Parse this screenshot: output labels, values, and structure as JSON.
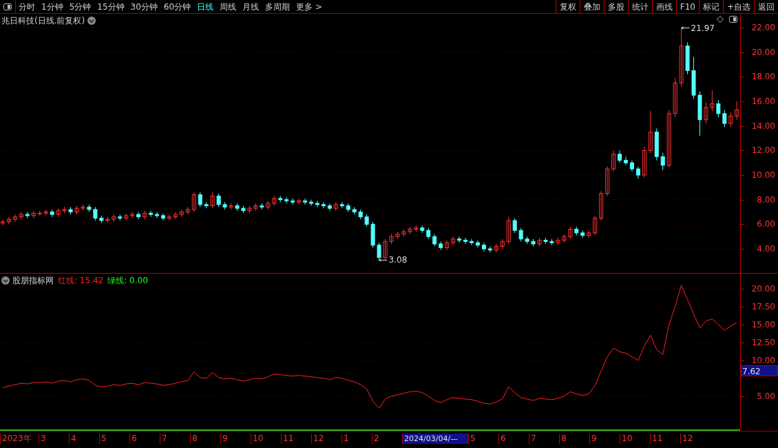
{
  "toolbar": {
    "periods": [
      {
        "label": "分时",
        "selected": false
      },
      {
        "label": "1分钟",
        "selected": false
      },
      {
        "label": "5分钟",
        "selected": false
      },
      {
        "label": "15分钟",
        "selected": false
      },
      {
        "label": "30分钟",
        "selected": false
      },
      {
        "label": "60分钟",
        "selected": false
      },
      {
        "label": "日线",
        "selected": true
      },
      {
        "label": "周线",
        "selected": false
      },
      {
        "label": "月线",
        "selected": false
      },
      {
        "label": "多周期",
        "selected": false
      },
      {
        "label": "更多 >",
        "selected": false
      }
    ],
    "actions": [
      "复权",
      "叠加",
      "多股",
      "统计",
      "画线",
      "F10",
      "标记",
      "+自选",
      "返回"
    ]
  },
  "price_pane": {
    "title": "兆日科技(日线.前复权)",
    "chart_data": {
      "type": "candlestick",
      "grid": true,
      "ylim": [
        2.04,
        23.12
      ],
      "yticks": [
        {
          "value": 4,
          "label": "4.00"
        },
        {
          "value": 6,
          "label": "6.00"
        },
        {
          "value": 8,
          "label": "8.00"
        },
        {
          "value": 10,
          "label": "10.00"
        },
        {
          "value": 12,
          "label": "12.00"
        },
        {
          "value": 14,
          "label": "14.00"
        },
        {
          "value": 16,
          "label": "16.00"
        },
        {
          "value": 18,
          "label": "18.00"
        },
        {
          "value": 20,
          "label": "20.00"
        },
        {
          "value": 22,
          "label": "22.00"
        }
      ],
      "ohlc": [
        [
          6.1,
          6.4,
          5.9,
          6.2
        ],
        [
          6.2,
          6.6,
          6.0,
          6.4
        ],
        [
          6.4,
          6.8,
          6.2,
          6.6
        ],
        [
          6.6,
          7.0,
          6.4,
          6.8
        ],
        [
          6.8,
          7.0,
          6.5,
          6.7
        ],
        [
          6.7,
          7.1,
          6.5,
          6.9
        ],
        [
          6.9,
          7.1,
          6.7,
          6.9
        ],
        [
          6.9,
          7.2,
          6.7,
          7.0
        ],
        [
          7.0,
          7.2,
          6.6,
          6.8
        ],
        [
          6.8,
          7.3,
          6.6,
          7.1
        ],
        [
          7.1,
          7.4,
          6.9,
          7.2
        ],
        [
          7.2,
          7.4,
          6.8,
          7.0
        ],
        [
          7.0,
          7.5,
          6.8,
          7.3
        ],
        [
          7.3,
          7.6,
          7.1,
          7.4
        ],
        [
          7.4,
          7.6,
          7.0,
          7.2
        ],
        [
          7.2,
          7.4,
          6.3,
          6.5
        ],
        [
          6.5,
          6.7,
          6.1,
          6.3
        ],
        [
          6.3,
          6.6,
          6.1,
          6.4
        ],
        [
          6.4,
          6.8,
          6.2,
          6.6
        ],
        [
          6.6,
          6.8,
          6.3,
          6.5
        ],
        [
          6.5,
          6.9,
          6.3,
          6.7
        ],
        [
          6.7,
          7.0,
          6.5,
          6.8
        ],
        [
          6.8,
          7.0,
          6.4,
          6.6
        ],
        [
          6.6,
          7.1,
          6.4,
          6.9
        ],
        [
          6.9,
          7.1,
          6.6,
          6.8
        ],
        [
          6.8,
          7.0,
          6.5,
          6.7
        ],
        [
          6.7,
          6.9,
          6.3,
          6.5
        ],
        [
          6.5,
          6.8,
          6.3,
          6.6
        ],
        [
          6.6,
          7.0,
          6.4,
          6.8
        ],
        [
          6.8,
          7.2,
          6.6,
          7.0
        ],
        [
          7.0,
          7.4,
          6.8,
          7.2
        ],
        [
          7.2,
          8.6,
          7.0,
          8.4
        ],
        [
          8.4,
          8.6,
          7.4,
          7.6
        ],
        [
          7.6,
          7.8,
          7.3,
          7.5
        ],
        [
          7.5,
          8.6,
          7.3,
          8.3
        ],
        [
          8.3,
          8.5,
          7.4,
          7.6
        ],
        [
          7.6,
          7.8,
          7.2,
          7.4
        ],
        [
          7.4,
          7.7,
          7.2,
          7.5
        ],
        [
          7.5,
          7.7,
          7.1,
          7.3
        ],
        [
          7.3,
          7.5,
          6.9,
          7.1
        ],
        [
          7.1,
          7.5,
          6.9,
          7.3
        ],
        [
          7.3,
          7.7,
          7.1,
          7.5
        ],
        [
          7.5,
          7.7,
          7.2,
          7.4
        ],
        [
          7.4,
          7.9,
          7.2,
          7.7
        ],
        [
          7.7,
          8.3,
          7.5,
          8.1
        ],
        [
          8.1,
          8.3,
          7.8,
          8.0
        ],
        [
          8.0,
          8.2,
          7.7,
          7.9
        ],
        [
          7.9,
          8.1,
          7.6,
          7.8
        ],
        [
          7.8,
          8.1,
          7.6,
          7.9
        ],
        [
          7.9,
          8.1,
          7.6,
          7.8
        ],
        [
          7.8,
          8.0,
          7.5,
          7.7
        ],
        [
          7.7,
          7.9,
          7.4,
          7.6
        ],
        [
          7.6,
          7.8,
          7.3,
          7.5
        ],
        [
          7.5,
          7.7,
          7.1,
          7.3
        ],
        [
          7.3,
          7.8,
          7.1,
          7.6
        ],
        [
          7.6,
          7.8,
          7.3,
          7.5
        ],
        [
          7.5,
          7.7,
          7.0,
          7.2
        ],
        [
          7.2,
          7.4,
          6.8,
          7.0
        ],
        [
          7.0,
          7.2,
          6.4,
          6.6
        ],
        [
          6.6,
          6.8,
          5.8,
          6.0
        ],
        [
          6.0,
          6.2,
          4.1,
          4.3
        ],
        [
          4.3,
          4.5,
          3.08,
          3.3
        ],
        [
          3.3,
          4.8,
          3.1,
          4.6
        ],
        [
          4.6,
          5.2,
          4.4,
          5.0
        ],
        [
          5.0,
          5.4,
          4.8,
          5.2
        ],
        [
          5.2,
          5.6,
          5.0,
          5.4
        ],
        [
          5.4,
          5.8,
          5.2,
          5.6
        ],
        [
          5.6,
          5.9,
          5.4,
          5.7
        ],
        [
          5.7,
          5.9,
          5.3,
          5.5
        ],
        [
          5.5,
          5.7,
          4.8,
          5.0
        ],
        [
          5.0,
          5.2,
          4.2,
          4.4
        ],
        [
          4.4,
          4.6,
          3.9,
          4.1
        ],
        [
          4.1,
          4.7,
          3.9,
          4.5
        ],
        [
          4.5,
          5.0,
          4.3,
          4.8
        ],
        [
          4.8,
          5.0,
          4.5,
          4.7
        ],
        [
          4.7,
          4.9,
          4.4,
          4.6
        ],
        [
          4.6,
          4.8,
          4.3,
          4.5
        ],
        [
          4.5,
          4.7,
          4.1,
          4.3
        ],
        [
          4.3,
          4.5,
          3.8,
          4.0
        ],
        [
          4.0,
          4.2,
          3.7,
          3.9
        ],
        [
          3.9,
          4.4,
          3.7,
          4.2
        ],
        [
          4.2,
          4.8,
          4.0,
          4.6
        ],
        [
          4.6,
          6.6,
          4.4,
          6.3
        ],
        [
          6.3,
          6.5,
          5.3,
          5.5
        ],
        [
          5.5,
          5.7,
          4.6,
          4.8
        ],
        [
          4.8,
          5.0,
          4.4,
          4.6
        ],
        [
          4.6,
          4.8,
          4.2,
          4.4
        ],
        [
          4.4,
          4.9,
          4.2,
          4.7
        ],
        [
          4.7,
          4.9,
          4.4,
          4.6
        ],
        [
          4.6,
          4.8,
          4.3,
          4.5
        ],
        [
          4.5,
          4.9,
          4.3,
          4.7
        ],
        [
          4.7,
          5.2,
          4.5,
          5.0
        ],
        [
          5.0,
          5.8,
          4.8,
          5.6
        ],
        [
          5.6,
          5.8,
          5.1,
          5.3
        ],
        [
          5.3,
          5.5,
          4.9,
          5.1
        ],
        [
          5.1,
          5.5,
          4.9,
          5.3
        ],
        [
          5.3,
          6.7,
          5.1,
          6.5
        ],
        [
          6.5,
          8.7,
          6.3,
          8.5
        ],
        [
          8.5,
          10.7,
          8.3,
          10.5
        ],
        [
          10.5,
          12.0,
          10.3,
          11.7
        ],
        [
          11.7,
          12.0,
          11.0,
          11.2
        ],
        [
          11.2,
          11.5,
          10.8,
          11.0
        ],
        [
          11.0,
          11.2,
          10.3,
          10.5
        ],
        [
          10.5,
          10.7,
          9.7,
          10.0
        ],
        [
          10.0,
          12.3,
          9.8,
          12.0
        ],
        [
          12.0,
          15.2,
          11.8,
          13.5
        ],
        [
          13.5,
          13.8,
          11.2,
          11.5
        ],
        [
          11.5,
          11.8,
          10.4,
          10.8
        ],
        [
          10.8,
          15.3,
          10.6,
          15.0
        ],
        [
          15.0,
          17.9,
          14.7,
          17.5
        ],
        [
          17.5,
          21.97,
          17.2,
          20.5
        ],
        [
          20.5,
          20.8,
          18.2,
          18.5
        ],
        [
          18.5,
          19.6,
          16.2,
          16.5
        ],
        [
          16.5,
          16.8,
          13.2,
          14.5
        ],
        [
          14.5,
          15.9,
          14.2,
          15.5
        ],
        [
          15.5,
          16.9,
          15.2,
          15.8
        ],
        [
          15.8,
          16.1,
          14.7,
          15.0
        ],
        [
          15.0,
          15.3,
          13.9,
          14.2
        ],
        [
          14.2,
          15.1,
          13.9,
          14.8
        ],
        [
          14.8,
          16.0,
          14.5,
          15.3
        ]
      ],
      "annotations": [
        "21.97",
        "3.08"
      ]
    }
  },
  "indicator_pane": {
    "title": "股朋指标网",
    "legend": [
      {
        "text": "红线: 15.42",
        "color": "#ff2020"
      },
      {
        "text": "绿线: 0.00",
        "color": "#20ff20"
      }
    ],
    "current_value": "7.62",
    "chart_data": {
      "type": "line",
      "grid": true,
      "ylim": [
        0.35,
        22.13
      ],
      "yticks": [
        {
          "value": 5,
          "label": "5.00"
        },
        {
          "value": 10,
          "label": "10.00"
        },
        {
          "value": 12.5,
          "label": "12.50"
        },
        {
          "value": 15,
          "label": "15.00"
        },
        {
          "value": 17.5,
          "label": "17.50"
        },
        {
          "value": 20,
          "label": "20.00"
        }
      ],
      "series": [
        {
          "color": "#ff2020",
          "values": [
            6.2,
            6.4,
            6.6,
            6.8,
            6.7,
            6.9,
            6.9,
            7.0,
            6.8,
            7.1,
            7.2,
            7.0,
            7.3,
            7.4,
            7.2,
            6.5,
            6.3,
            6.4,
            6.6,
            6.5,
            6.7,
            6.8,
            6.6,
            6.9,
            6.8,
            6.7,
            6.5,
            6.6,
            6.8,
            7.0,
            7.2,
            8.4,
            7.6,
            7.5,
            8.3,
            7.6,
            7.4,
            7.5,
            7.3,
            7.1,
            7.3,
            7.5,
            7.4,
            7.7,
            8.1,
            8.0,
            7.9,
            7.8,
            7.9,
            7.8,
            7.7,
            7.6,
            7.5,
            7.3,
            7.6,
            7.5,
            7.2,
            7.0,
            6.6,
            6.0,
            4.3,
            3.3,
            4.6,
            5.0,
            5.2,
            5.4,
            5.6,
            5.7,
            5.5,
            5.0,
            4.4,
            4.1,
            4.5,
            4.8,
            4.7,
            4.6,
            4.5,
            4.3,
            4.0,
            3.9,
            4.2,
            4.6,
            6.3,
            5.5,
            4.8,
            4.6,
            4.4,
            4.7,
            4.6,
            4.5,
            4.7,
            5.0,
            5.6,
            5.3,
            5.1,
            5.3,
            6.5,
            8.5,
            10.5,
            11.7,
            11.2,
            11.0,
            10.5,
            10.0,
            12.0,
            13.5,
            11.5,
            10.8,
            15.0,
            17.5,
            20.5,
            18.5,
            16.5,
            14.5,
            15.5,
            15.8,
            15.0,
            14.2,
            14.8,
            15.3
          ]
        }
      ]
    }
  },
  "time_axis": [
    {
      "label": "2023年",
      "selected": false
    },
    {
      "label": "3",
      "selected": false
    },
    {
      "label": "4",
      "selected": false
    },
    {
      "label": "5",
      "selected": false
    },
    {
      "label": "6",
      "selected": false
    },
    {
      "label": "7",
      "selected": false
    },
    {
      "label": "8",
      "selected": false
    },
    {
      "label": "9",
      "selected": false
    },
    {
      "label": "10",
      "selected": false
    },
    {
      "label": "11",
      "selected": false
    },
    {
      "label": "12",
      "selected": false
    },
    {
      "label": "1",
      "selected": false
    },
    {
      "label": "2",
      "selected": false
    },
    {
      "label": "2024/03/04/—",
      "selected": true
    },
    {
      "label": "5",
      "selected": false
    },
    {
      "label": "6",
      "selected": false
    },
    {
      "label": "7",
      "selected": false
    },
    {
      "label": "8",
      "selected": false
    },
    {
      "label": "9",
      "selected": false
    },
    {
      "label": "10",
      "selected": false
    },
    {
      "label": "11",
      "selected": false
    },
    {
      "label": "12",
      "selected": false
    }
  ]
}
